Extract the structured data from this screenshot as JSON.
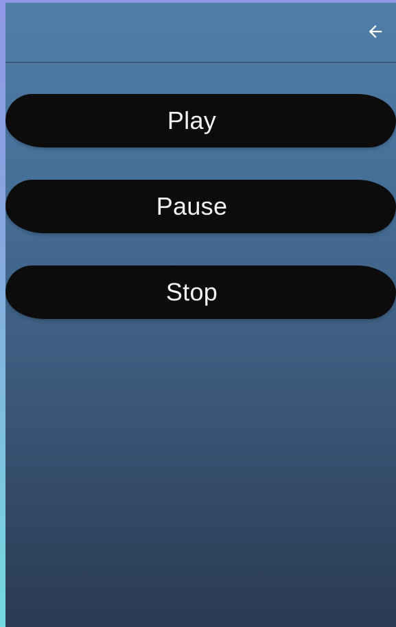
{
  "app_bar": {
    "back_icon": "arrow-left-icon"
  },
  "controls": [
    {
      "label": "Play"
    },
    {
      "label": "Pause"
    },
    {
      "label": "Stop"
    }
  ],
  "colors": {
    "button_bg": "#0c0c0c",
    "button_text": "#f4f4f4",
    "background_top": "#4f7ea8",
    "background_bottom": "#2a3a52",
    "icon": "#ffffff"
  }
}
